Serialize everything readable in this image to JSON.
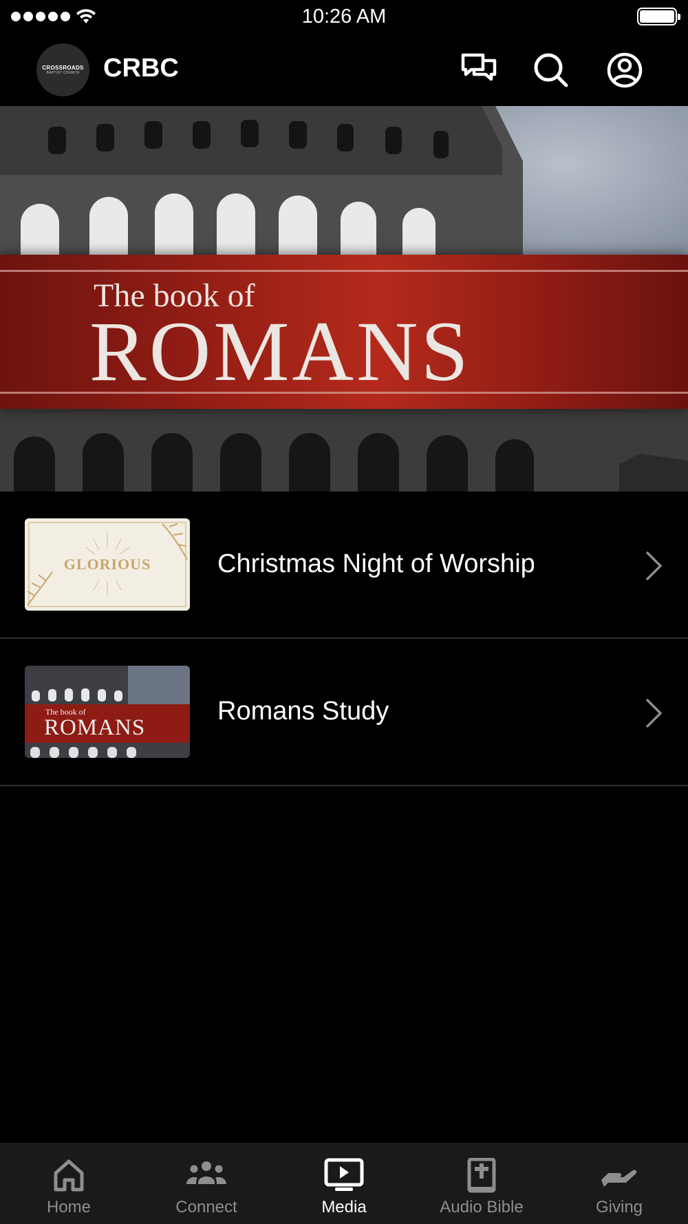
{
  "status_bar": {
    "time": "10:26 AM"
  },
  "header": {
    "logo_text": "CROSSROADS",
    "logo_subtext": "BAPTIST CHURCH",
    "title": "CRBC",
    "icons": [
      "chat-icon",
      "search-icon",
      "profile-icon"
    ]
  },
  "hero": {
    "subtitle": "The book of",
    "title": "ROMANS",
    "page_count": 2,
    "active_page": 1
  },
  "media_list": [
    {
      "label": "Christmas Night of Worship",
      "thumbnail_text": "GLORIOUS"
    },
    {
      "label": "Romans Study",
      "thumbnail_subtitle": "The book of",
      "thumbnail_title": "ROMANS"
    }
  ],
  "tab_bar": {
    "tabs": [
      {
        "label": "Home",
        "icon": "home-icon",
        "active": false
      },
      {
        "label": "Connect",
        "icon": "group-icon",
        "active": false
      },
      {
        "label": "Media",
        "icon": "tv-play-icon",
        "active": true
      },
      {
        "label": "Audio Bible",
        "icon": "bible-icon",
        "active": false
      },
      {
        "label": "Giving",
        "icon": "giving-hand-icon",
        "active": false
      }
    ]
  },
  "colors": {
    "background": "#000000",
    "tab_bar": "#1a1a1a",
    "tab_inactive": "#8e8e8e",
    "tab_active": "#ffffff",
    "hero_band": "#9a2016"
  }
}
